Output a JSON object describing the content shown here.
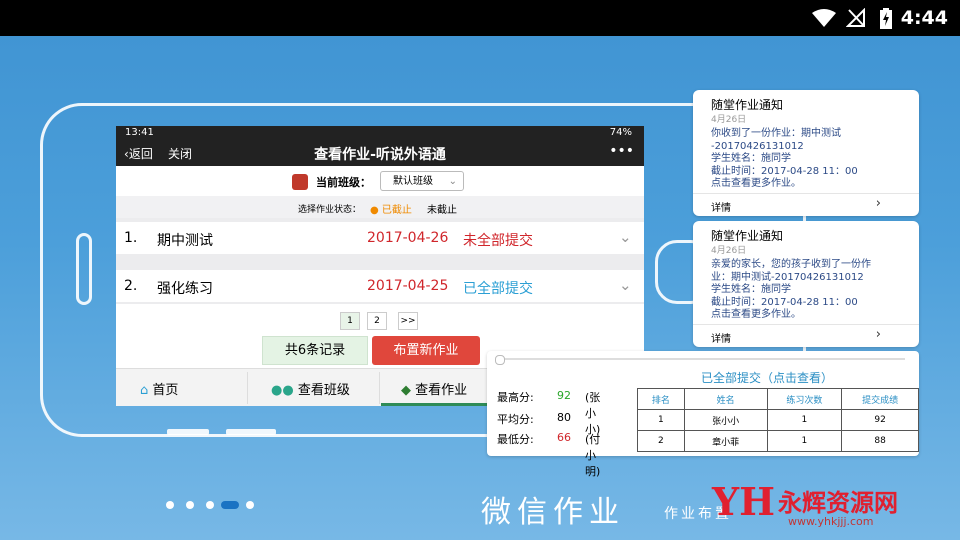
{
  "device_status": {
    "time": "4:44"
  },
  "phone": {
    "status_time": "13:41",
    "battery": "74%",
    "nav": {
      "back": "返回",
      "close": "关闭",
      "title": "查看作业-听说外语通",
      "more": "•••"
    },
    "class_label": "当前班级：",
    "class_select": "默认班级",
    "filter_label": "选择作业状态：",
    "filter_options": [
      "● 已截止",
      "未截止"
    ],
    "homework": [
      {
        "num": "1.",
        "name": "期中测试",
        "date": "2017-04-26",
        "status": "未全部提交",
        "status_color": "#d0262b"
      },
      {
        "num": "2.",
        "name": "强化练习",
        "date": "2017-04-25",
        "status": "已全部提交",
        "status_color": "#2b9fd4"
      }
    ],
    "pages": [
      "1",
      "2",
      ">>"
    ],
    "record_count": "共6条记录",
    "new_button": "布置新作业",
    "tabs": [
      "首页",
      "查看班级",
      "查看作业"
    ]
  },
  "notifications": [
    {
      "title": "随堂作业通知",
      "date": "4月26日",
      "body": "你收到了一份作业：期中测试\n-20170426131012\n学生姓名：施同学\n截止时间：2017-04-28 11：00\n点击查看更多作业。",
      "detail": "详情"
    },
    {
      "title": "随堂作业通知",
      "date": "4月26日",
      "body": "亲爱的家长，您的孩子收到了一份作\n业：期中测试-20170426131012\n学生姓名：施同学\n截止时间：2017-04-28 11：00\n点击查看更多作业。",
      "detail": "详情"
    }
  ],
  "stats": {
    "max_label": "最高分:",
    "max_value": "92",
    "max_who": "(张小小)",
    "avg_label": "平均分:",
    "avg_value": "80",
    "min_label": "最低分:",
    "min_value": "66",
    "min_who": "(付小明)",
    "table_title": "已全部提交（点击查看）",
    "columns": [
      "排名",
      "姓名",
      "练习次数",
      "提交成绩"
    ],
    "rows": [
      [
        "1",
        "张小小",
        "1",
        "92"
      ],
      [
        "2",
        "章小菲",
        "1",
        "88"
      ]
    ]
  },
  "footer": {
    "title": "微信作业",
    "subtitle": "作业布置"
  },
  "watermark": {
    "logo": "YH",
    "name": "永辉资源网",
    "url": "www.yhkjjj.com"
  },
  "colors": {
    "accent": "#1a73c3",
    "red": "#d0262b",
    "blue": "#2b9fd4",
    "orange": "#f08a00"
  }
}
